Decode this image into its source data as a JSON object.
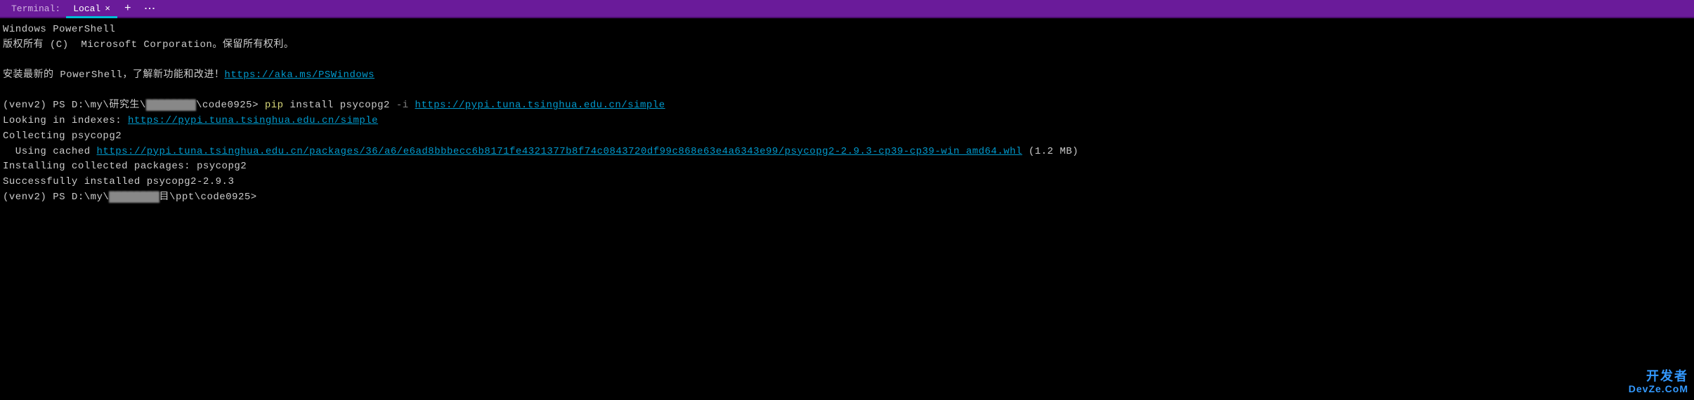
{
  "tabbar": {
    "label": "Terminal:",
    "tab_name": "Local",
    "close_glyph": "×",
    "add_glyph": "+",
    "menu_glyph": "⋮"
  },
  "terminal": {
    "line1": "Windows PowerShell",
    "line2": "版权所有 (C)  Microsoft Corporation。保留所有权利。",
    "line3_pre": "安装最新的 PowerShell，了解新功能和改进！",
    "line3_link": "https://aka.ms/PSWindows",
    "prompt1_pre": "(venv2) PS D:\\my\\研究生\\",
    "prompt1_censor": "████████",
    "prompt1_post": "\\code0925> ",
    "cmd1_a": "pip",
    "cmd1_b": " install psycopg2 ",
    "cmd1_c": "-i",
    "cmd1_d": " ",
    "cmd1_link": "https://pypi.tuna.tsinghua.edu.cn/simple",
    "line5_pre": "Looking in indexes: ",
    "line5_link": "https://pypi.tuna.tsinghua.edu.cn/simple",
    "line6": "Collecting psycopg2",
    "line7_pre": "  Using cached ",
    "line7_link": "https://pypi.tuna.tsinghua.edu.cn/packages/36/a6/e6ad8bbbecc6b8171fe4321377b8f74c0843720df99c868e63e4a6343e99/psycopg2-2.9.3-cp39-cp39-win_amd64.whl",
    "line7_post": " (1.2 MB)",
    "line8": "Installing collected packages: psycopg2",
    "line9": "Successfully installed psycopg2-2.9.3",
    "prompt2_pre": "(venv2) PS D:\\my\\",
    "prompt2_censor": "████████",
    "prompt2_post": "目\\ppt\\code0925>"
  },
  "watermark": {
    "top": "开发者",
    "bottom": "DevZe.CoM"
  }
}
